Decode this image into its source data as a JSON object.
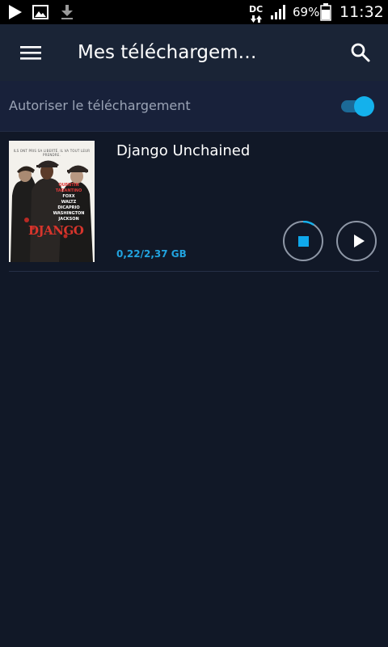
{
  "status_bar": {
    "network_label": "DC",
    "battery_percent": "69%",
    "time": "11:32",
    "icons": [
      "play-store-icon",
      "gallery-icon",
      "download-icon",
      "network-icon",
      "signal-icon",
      "battery-icon"
    ]
  },
  "toolbar": {
    "title": "Mes téléchargem…",
    "menu_icon": "hamburger-menu-icon",
    "search_icon": "search-icon"
  },
  "settings": {
    "allow_download_label": "Autoriser le téléchargement",
    "allow_download_enabled": true
  },
  "downloads": [
    {
      "title": "Django Unchained",
      "size_progress": "0,22/2,37 GB",
      "progress_fraction": 0.093,
      "poster": {
        "tagline": "ILS ONT PRIS SA LIBERTÉ. IL VA TOUT LEUR PRENDRE.",
        "credits_red": [
          "QUENTIN",
          "TARANTINO"
        ],
        "credits": [
          "FOXX",
          "WALTZ",
          "DICAPRIO",
          "WASHINGTON",
          "JACKSON"
        ],
        "logo": "DJANGO"
      }
    }
  ],
  "colors": {
    "accent": "#14b1ec",
    "background": "#111827",
    "toolbar": "#1a2436"
  }
}
